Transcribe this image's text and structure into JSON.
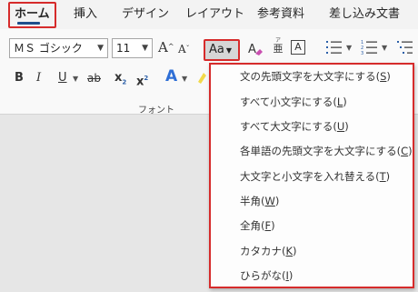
{
  "tabs": [
    {
      "label": "ホーム"
    },
    {
      "label": "挿入"
    },
    {
      "label": "デザイン"
    },
    {
      "label": "レイアウト"
    },
    {
      "label": "参考資料"
    },
    {
      "label": "差し込み文書"
    }
  ],
  "ribbon": {
    "font_name": "ＭＳ ゴシック",
    "font_size": "11",
    "change_case_label": "Aa",
    "font_group_label": "フォント",
    "letters": {
      "grow": "A",
      "shrink": "A",
      "bold": "B",
      "italic": "I",
      "underline": "U",
      "strike": "ab",
      "sub": "x",
      "sub_mark": "2",
      "sup": "x",
      "sup_mark": "2",
      "effects": "A",
      "phonetic": "亜",
      "border": "A"
    }
  },
  "change_case_menu": {
    "items": [
      {
        "text": "文の先頭文字を大文字にする(",
        "key": "S",
        "close": ")"
      },
      {
        "text": "すべて小文字にする(",
        "key": "L",
        "close": ")"
      },
      {
        "text": "すべて大文字にする(",
        "key": "U",
        "close": ")"
      },
      {
        "text": "各単語の先頭文字を大文字にする(",
        "key": "C",
        "close": ")"
      },
      {
        "text": "大文字と小文字を入れ替える(",
        "key": "T",
        "close": ")"
      },
      {
        "text": "半角(",
        "key": "W",
        "close": ")"
      },
      {
        "text": "全角(",
        "key": "F",
        "close": ")"
      },
      {
        "text": "カタカナ(",
        "key": "K",
        "close": ")"
      },
      {
        "text": "ひらがな(",
        "key": "I",
        "close": ")"
      }
    ]
  },
  "colors": {
    "highlight_border": "#d62b2b",
    "active_tab_underline": "#1f4e8c",
    "text_effects_blue": "#2f6fd6"
  }
}
